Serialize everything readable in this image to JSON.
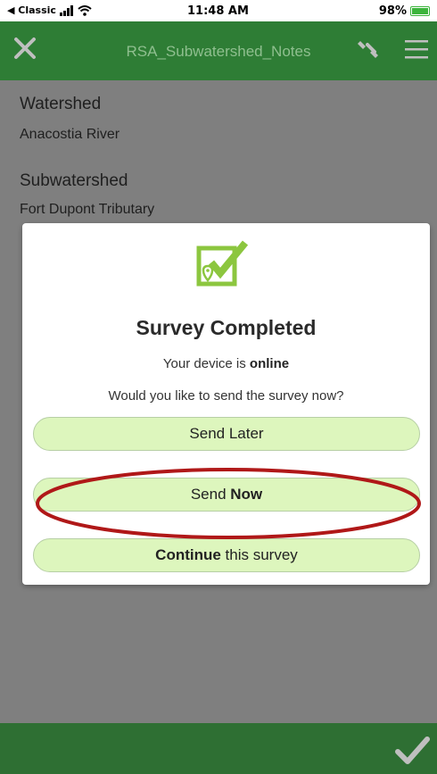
{
  "status_bar": {
    "back_label": "◀ Classic",
    "time": "11:48 AM",
    "battery": "98%"
  },
  "header": {
    "title": "RSA_Subwatershed_Notes"
  },
  "form": {
    "fields": [
      {
        "label": "Watershed",
        "value": "Anacostia River"
      },
      {
        "label": "Subwatershed",
        "value": "Fort Dupont Tributary"
      }
    ]
  },
  "dialog": {
    "title": "Survey Completed",
    "status_prefix": "Your device is ",
    "status_value": "online",
    "question": "Would you like to send the survey now?",
    "buttons": {
      "send_later": "Send Later",
      "send_now_prefix": "Send ",
      "send_now_bold": "Now",
      "continue_bold": "Continue",
      "continue_suffix": " this survey"
    }
  },
  "colors": {
    "header_bg": "#2e7d35",
    "footer_bg": "#2e6f33",
    "button_bg": "#ddf6bd",
    "icon_green": "#8cc63f",
    "highlight": "#b01818",
    "overlay": "#7f7f7f"
  }
}
